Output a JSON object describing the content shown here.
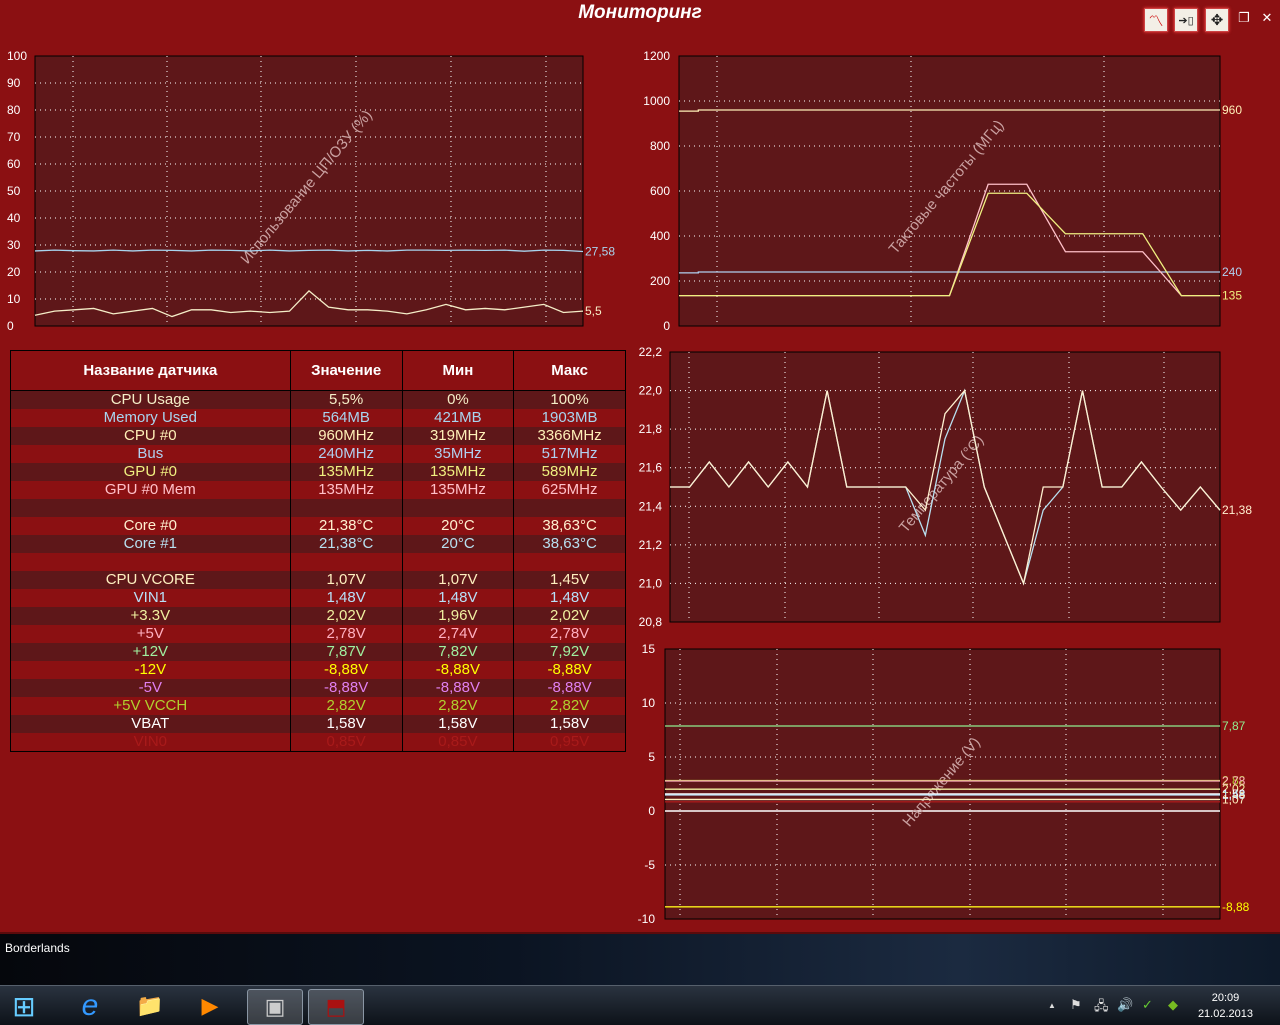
{
  "window": {
    "title": "Мониторинг",
    "buttons": [
      {
        "name": "graph-icon",
        "glyph": "〽"
      },
      {
        "name": "dock-icon",
        "glyph": "➔▯"
      },
      {
        "name": "move-icon",
        "glyph": "✥"
      },
      {
        "name": "restore-icon",
        "glyph": "❐"
      },
      {
        "name": "close-icon",
        "glyph": "✕"
      }
    ]
  },
  "table": {
    "headers": [
      "Название датчика",
      "Значение",
      "Мин",
      "Макс"
    ],
    "rows": [
      {
        "name": "CPU Usage",
        "value": "5,5%",
        "min": "0%",
        "max": "100%",
        "color": "#f5eec8"
      },
      {
        "name": "Memory Used",
        "value": "564MB",
        "min": "421MB",
        "max": "1903MB",
        "color": "#a8d4ee"
      },
      {
        "name": "CPU #0",
        "value": "960MHz",
        "min": "319MHz",
        "max": "3366MHz",
        "color": "#fff0b8"
      },
      {
        "name": "Bus",
        "value": "240MHz",
        "min": "35MHz",
        "max": "517MHz",
        "color": "#b0d0f0"
      },
      {
        "name": "GPU #0",
        "value": "135MHz",
        "min": "135MHz",
        "max": "589MHz",
        "color": "#f0f080"
      },
      {
        "name": "GPU #0 Mem",
        "value": "135MHz",
        "min": "135MHz",
        "max": "625MHz",
        "color": "#ffc0c8"
      },
      {
        "name": "",
        "value": "",
        "min": "",
        "max": "",
        "color": "#ffffff"
      },
      {
        "name": "Core #0",
        "value": "21,38°C",
        "min": "20°C",
        "max": "38,63°C",
        "color": "#fff0d0"
      },
      {
        "name": "Core #1",
        "value": "21,38°C",
        "min": "20°C",
        "max": "38,63°C",
        "color": "#b8e0f0"
      },
      {
        "name": "",
        "value": "",
        "min": "",
        "max": "",
        "color": "#ffffff"
      },
      {
        "name": "CPU VCORE",
        "value": "1,07V",
        "min": "1,07V",
        "max": "1,45V",
        "color": "#fff0c0"
      },
      {
        "name": "VIN1",
        "value": "1,48V",
        "min": "1,48V",
        "max": "1,48V",
        "color": "#b8e0f8"
      },
      {
        "name": "+3.3V",
        "value": "2,02V",
        "min": "1,96V",
        "max": "2,02V",
        "color": "#f0f0a0"
      },
      {
        "name": "+5V",
        "value": "2,78V",
        "min": "2,74V",
        "max": "2,78V",
        "color": "#ffb0c0"
      },
      {
        "name": "+12V",
        "value": "7,87V",
        "min": "7,82V",
        "max": "7,92V",
        "color": "#a0f0a0"
      },
      {
        "name": "-12V",
        "value": "-8,88V",
        "min": "-8,88V",
        "max": "-8,88V",
        "color": "#ffff00"
      },
      {
        "name": "-5V",
        "value": "-8,88V",
        "min": "-8,88V",
        "max": "-8,88V",
        "color": "#e080f0"
      },
      {
        "name": "+5V VCCH",
        "value": "2,82V",
        "min": "2,82V",
        "max": "2,82V",
        "color": "#b0d030"
      },
      {
        "name": "VBAT",
        "value": "1,58V",
        "min": "1,58V",
        "max": "1,58V",
        "color": "#ffffff"
      },
      {
        "name": "VIN0",
        "value": "0,85V",
        "min": "0,85V",
        "max": "0,95V",
        "color": "#a81a1a"
      }
    ]
  },
  "chart_data": [
    {
      "id": "usage",
      "type": "line",
      "title": "Использование ЦП/ОЗУ (%)",
      "ylim": [
        0,
        100
      ],
      "xlim": [
        0,
        28
      ],
      "yticks": [
        "0",
        "10",
        "20",
        "30",
        "40",
        "50",
        "60",
        "70",
        "80",
        "90",
        "100"
      ],
      "grid": true,
      "series": [
        {
          "name": "Memory Used",
          "color": "#a8d4ee",
          "label": "27,58",
          "values": [
            27.8,
            28.1,
            27.9,
            27.8,
            28.1,
            27.8,
            28.1,
            28.0,
            27.8,
            28.1,
            28.0,
            27.8,
            28.1,
            27.8,
            28.0,
            28.1,
            27.8,
            28.0,
            27.8,
            28.1,
            28.1,
            28.0,
            28.1,
            28.0,
            28.1,
            27.7,
            28.1,
            28.0,
            27.6
          ]
        },
        {
          "name": "CPU Usage",
          "color": "#f5eec8",
          "label": "5,5",
          "values": [
            4,
            5.5,
            6,
            6.5,
            4.5,
            5.5,
            6.5,
            3.5,
            6,
            6,
            5,
            5.5,
            5,
            5.5,
            13,
            7,
            6,
            6,
            5.5,
            4.5,
            6,
            8,
            6,
            6.5,
            6,
            7,
            8,
            5,
            5.5
          ]
        }
      ]
    },
    {
      "id": "clocks",
      "type": "line",
      "title": "Тактовые частоты (МГц)",
      "ylim": [
        0,
        1200
      ],
      "xlim": [
        0,
        28
      ],
      "yticks": [
        "0",
        "200",
        "400",
        "600",
        "800",
        "1000",
        "1200"
      ],
      "grid": true,
      "series": [
        {
          "name": "CPU #0",
          "color": "#fff0b8",
          "label": "960",
          "points": [
            [
              0,
              955
            ],
            [
              1,
              955
            ],
            [
              1,
              960
            ],
            [
              28,
              960
            ]
          ]
        },
        {
          "name": "Bus",
          "color": "#b0d0f0",
          "label": "240",
          "points": [
            [
              0,
              236
            ],
            [
              1,
              236
            ],
            [
              1,
              240
            ],
            [
              28,
              240
            ]
          ]
        },
        {
          "name": "GPU #0 Mem",
          "color": "#ffc0c8",
          "label": "",
          "points": [
            [
              0,
              135
            ],
            [
              14,
              135
            ],
            [
              16,
              630
            ],
            [
              18,
              630
            ],
            [
              20,
              330
            ],
            [
              24,
              330
            ],
            [
              26,
              135
            ],
            [
              28,
              135
            ]
          ]
        },
        {
          "name": "GPU #0",
          "color": "#f0f080",
          "label": "135",
          "points": [
            [
              0,
              135
            ],
            [
              14,
              135
            ],
            [
              16,
              590
            ],
            [
              18,
              590
            ],
            [
              20,
              410
            ],
            [
              24,
              410
            ],
            [
              26,
              135
            ],
            [
              28,
              135
            ]
          ]
        }
      ]
    },
    {
      "id": "temps",
      "type": "line",
      "title": "Температура (°C)",
      "ylim": [
        20.8,
        22.2
      ],
      "xlim": [
        0,
        28
      ],
      "yticks": [
        "20,8",
        "21,0",
        "21,2",
        "21,4",
        "21,6",
        "21,8",
        "22,0",
        "22,2"
      ],
      "grid": true,
      "series": [
        {
          "name": "Core #1",
          "color": "#b8e0f0",
          "label": "",
          "values": [
            21.5,
            21.5,
            21.63,
            21.5,
            21.63,
            21.5,
            21.63,
            21.5,
            22.0,
            21.5,
            21.5,
            21.5,
            21.5,
            21.25,
            21.75,
            22.0,
            21.5,
            21.25,
            21.0,
            21.38,
            21.5,
            22.0,
            21.5,
            21.5,
            21.63,
            21.5,
            21.38,
            21.5,
            21.38
          ]
        },
        {
          "name": "Core #0",
          "color": "#fff0d0",
          "label": "21,38",
          "values": [
            21.5,
            21.5,
            21.63,
            21.5,
            21.63,
            21.5,
            21.63,
            21.5,
            22.0,
            21.5,
            21.5,
            21.5,
            21.5,
            21.38,
            21.88,
            22.0,
            21.5,
            21.25,
            21.0,
            21.5,
            21.5,
            22.0,
            21.5,
            21.5,
            21.63,
            21.5,
            21.38,
            21.5,
            21.38
          ]
        }
      ]
    },
    {
      "id": "volts",
      "type": "line",
      "title": "Напряжение (V)",
      "ylim": [
        -10,
        15
      ],
      "xlim": [
        0,
        28
      ],
      "yticks": [
        "-10",
        "-5",
        "0",
        "5",
        "10",
        "15"
      ],
      "grid": true,
      "series": [
        {
          "name": "+12V",
          "color": "#90ee90",
          "label": "7,87",
          "values": [
            7.87
          ]
        },
        {
          "name": "+5V VCCH",
          "color": "#b0d030",
          "label": "2,82",
          "values": [
            2.82
          ]
        },
        {
          "name": "+5V",
          "color": "#ffb0c0",
          "label": "2,78",
          "values": [
            2.78
          ]
        },
        {
          "name": "+3.3V",
          "color": "#f0f0a0",
          "label": "2,02",
          "values": [
            2.02
          ]
        },
        {
          "name": "VBAT",
          "color": "#ffffff",
          "label": "1,58",
          "values": [
            1.58
          ]
        },
        {
          "name": "VIN1",
          "color": "#b8e0f8",
          "label": "1,48",
          "values": [
            1.48
          ]
        },
        {
          "name": "CPU VCORE",
          "color": "#fff0c0",
          "label": "1,07",
          "values": [
            1.07
          ]
        },
        {
          "name": "VIN0",
          "color": "#a81a1a",
          "label": "",
          "values": [
            0.85
          ]
        },
        {
          "name": "-5V",
          "color": "#e080f0",
          "label": "",
          "values": [
            -8.88
          ]
        },
        {
          "name": "-12V",
          "color": "#ffff00",
          "label": "-8,88",
          "values": [
            -8.88
          ]
        }
      ]
    }
  ],
  "desktop": {
    "shortcut_label": "Borderlands"
  },
  "taskbar": {
    "items": [
      {
        "name": "start-button",
        "glyph": "⊞"
      },
      {
        "name": "internet-explorer-icon",
        "glyph": "e"
      },
      {
        "name": "explorer-icon",
        "glyph": "📁"
      },
      {
        "name": "media-player-icon",
        "glyph": "▶"
      },
      {
        "name": "monitor-app-icon",
        "glyph": "▣"
      },
      {
        "name": "aida-app-icon",
        "glyph": "⬒"
      }
    ],
    "tray": [
      "▲",
      "⚑",
      "🖧",
      "🔊",
      "✓",
      "◆"
    ],
    "time": "20:09",
    "date": "21.02.2013"
  }
}
